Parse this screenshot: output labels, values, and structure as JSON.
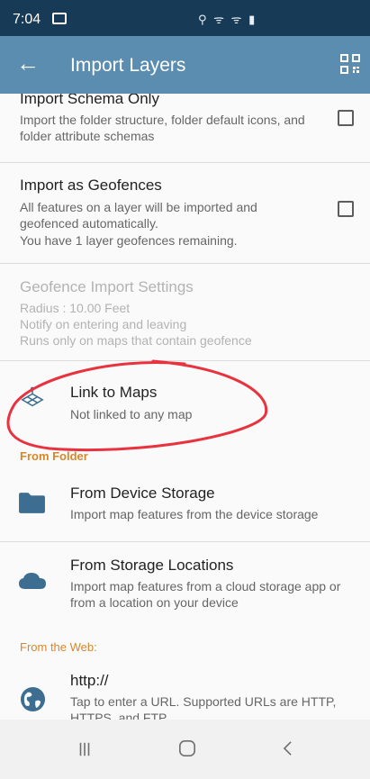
{
  "status": {
    "time": "7:04",
    "icons": "⚲ ᯤ ᯤ ▮"
  },
  "appbar": {
    "back": "←",
    "title": "Import Layers"
  },
  "items": {
    "schema": {
      "title": "Import Schema Only",
      "desc": "Import the folder structure, folder default icons, and folder attribute schemas"
    },
    "geofences": {
      "title": "Import as Geofences",
      "line1": "All features on a layer will be imported and geofenced automatically.",
      "line2": "You have 1 layer geofences remaining."
    },
    "geo_settings": {
      "title": "Geofence Import Settings",
      "line1": "Radius : 10.00 Feet",
      "line2": "Notify on entering and leaving",
      "line3": "Runs only on maps that contain geofence"
    },
    "link": {
      "title": "Link to Maps",
      "desc": "Not linked to any map"
    },
    "section_folder": "From Folder",
    "device": {
      "title": "From Device Storage",
      "desc": "Import map features from the device storage"
    },
    "storage": {
      "title": "From Storage Locations",
      "desc": "Import map features from a cloud storage app or from a location on your device"
    },
    "section_web": "From the Web:",
    "http": {
      "title": "http://",
      "desc": "Tap to enter a URL. Supported URLs are HTTP, HTTPS, and FTP."
    }
  },
  "colors": {
    "status_bar": "#173a56",
    "app_bar": "#5b8db0",
    "section_header": "#d4882c",
    "icon": "#3d6e92",
    "annotation": "#e8333f"
  }
}
